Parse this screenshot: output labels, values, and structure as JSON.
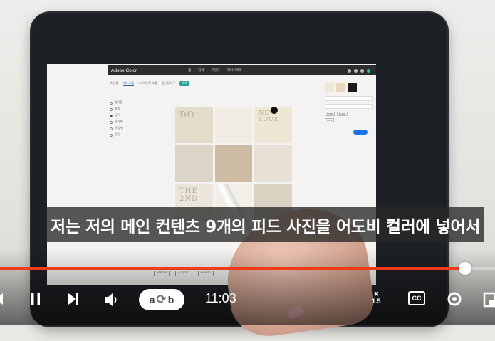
{
  "video": {
    "subtitle": "저는 저의 메인 컨텐츠 9개의 피드 사진을 어도비 컬러에 넣어서",
    "current_time": "11:03",
    "progress_fraction": 0.94,
    "speed_label": "1.5",
    "cc_label": "CC",
    "autoplay_left": "a",
    "autoplay_right": "b"
  },
  "app": {
    "title": "Adobe Color",
    "nav": [
      "홈",
      "탐색",
      "트렌드",
      "라이브러리"
    ],
    "tabs": [
      "색상 휠",
      "테마 추출",
      "그라디언트 추출",
      "접근성 도구"
    ],
    "tab_badge": "새로",
    "left_options": [
      "컬러풀",
      "밝게",
      "뮤트",
      "진하게",
      "어둡게",
      "없음"
    ],
    "grid_words": [
      "DO",
      "NEW LOOK",
      "THE 2ND"
    ],
    "right_tags": [
      "Beige",
      "Brown",
      "Gray"
    ],
    "bottom_codes": [
      "#F8F2E8",
      "#D7C7B2",
      "#A89276"
    ]
  },
  "colors": {
    "accent_progress": "#f03a17",
    "swatch_1": "#efe6d4",
    "swatch_2": "#e8d7bf",
    "swatch_3": "#1b1b1b"
  },
  "icons": [
    "previous-icon",
    "pause-icon",
    "next-icon",
    "volume-icon",
    "autoplay-toggle-icon",
    "speed-icon",
    "captions-icon",
    "settings-icon",
    "miniplayer-icon"
  ]
}
